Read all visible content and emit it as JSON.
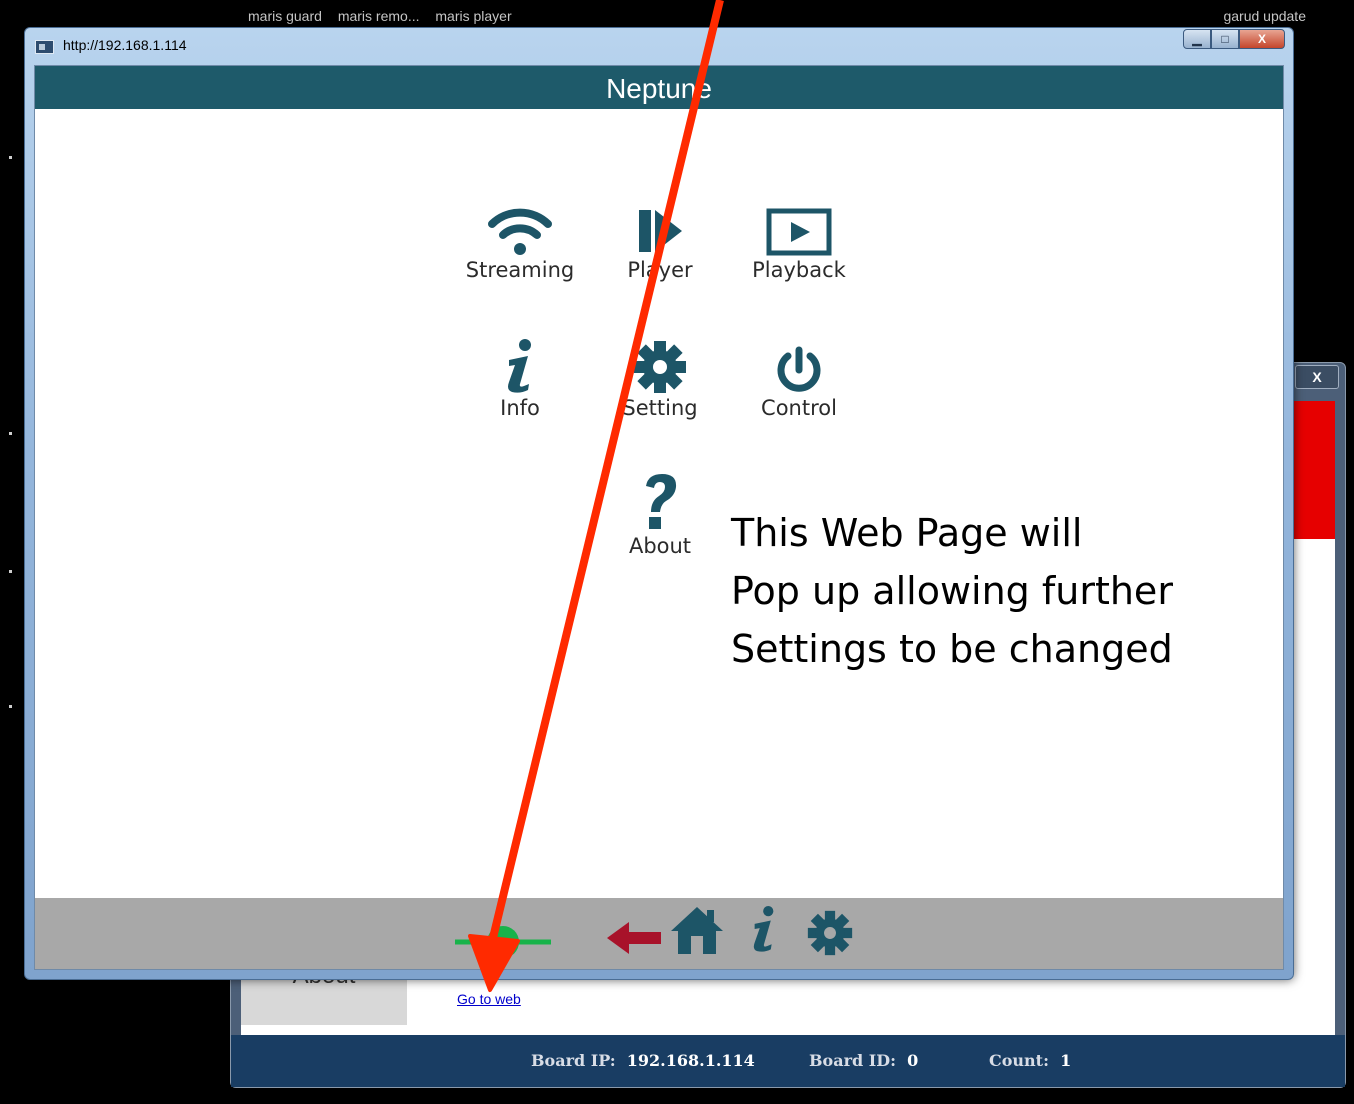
{
  "desktop": {
    "labels": [
      "maris guard",
      "maris remo...",
      "maris player"
    ],
    "right_label": "garud update"
  },
  "window": {
    "title": "http://192.168.1.114",
    "controls": {
      "minimize": "▁",
      "maximize": "□",
      "close": "X"
    }
  },
  "page": {
    "header": "Neptune",
    "menu": [
      {
        "label": "Streaming",
        "icon": "wifi-icon"
      },
      {
        "label": "Player",
        "icon": "player-icon"
      },
      {
        "label": "Playback",
        "icon": "playback-icon"
      },
      {
        "label": "Info",
        "icon": "info-icon"
      },
      {
        "label": "Setting",
        "icon": "gear-icon"
      },
      {
        "label": "Control",
        "icon": "power-icon"
      },
      {
        "label": "About",
        "icon": "question-icon"
      }
    ],
    "footer_icons": [
      "connection-status-icon",
      "back-arrow-icon",
      "home-icon",
      "info-icon",
      "gear-icon"
    ]
  },
  "annotation": {
    "lines": [
      "This Web Page will",
      "Pop up allowing further",
      "Settings to be changed"
    ],
    "color": "#ff2a00"
  },
  "background_window": {
    "close": "X",
    "tab_label": "About",
    "link": "Go to web",
    "status": {
      "board_ip_label": "Board IP:",
      "board_ip": "192.168.1.114",
      "board_id_label": "Board ID:",
      "board_id": "0",
      "count_label": "Count:",
      "count": "1"
    }
  },
  "colors": {
    "teal": "#1e5a6a",
    "status_bar": "#193d63",
    "footer_gray": "#a8a8a8"
  }
}
